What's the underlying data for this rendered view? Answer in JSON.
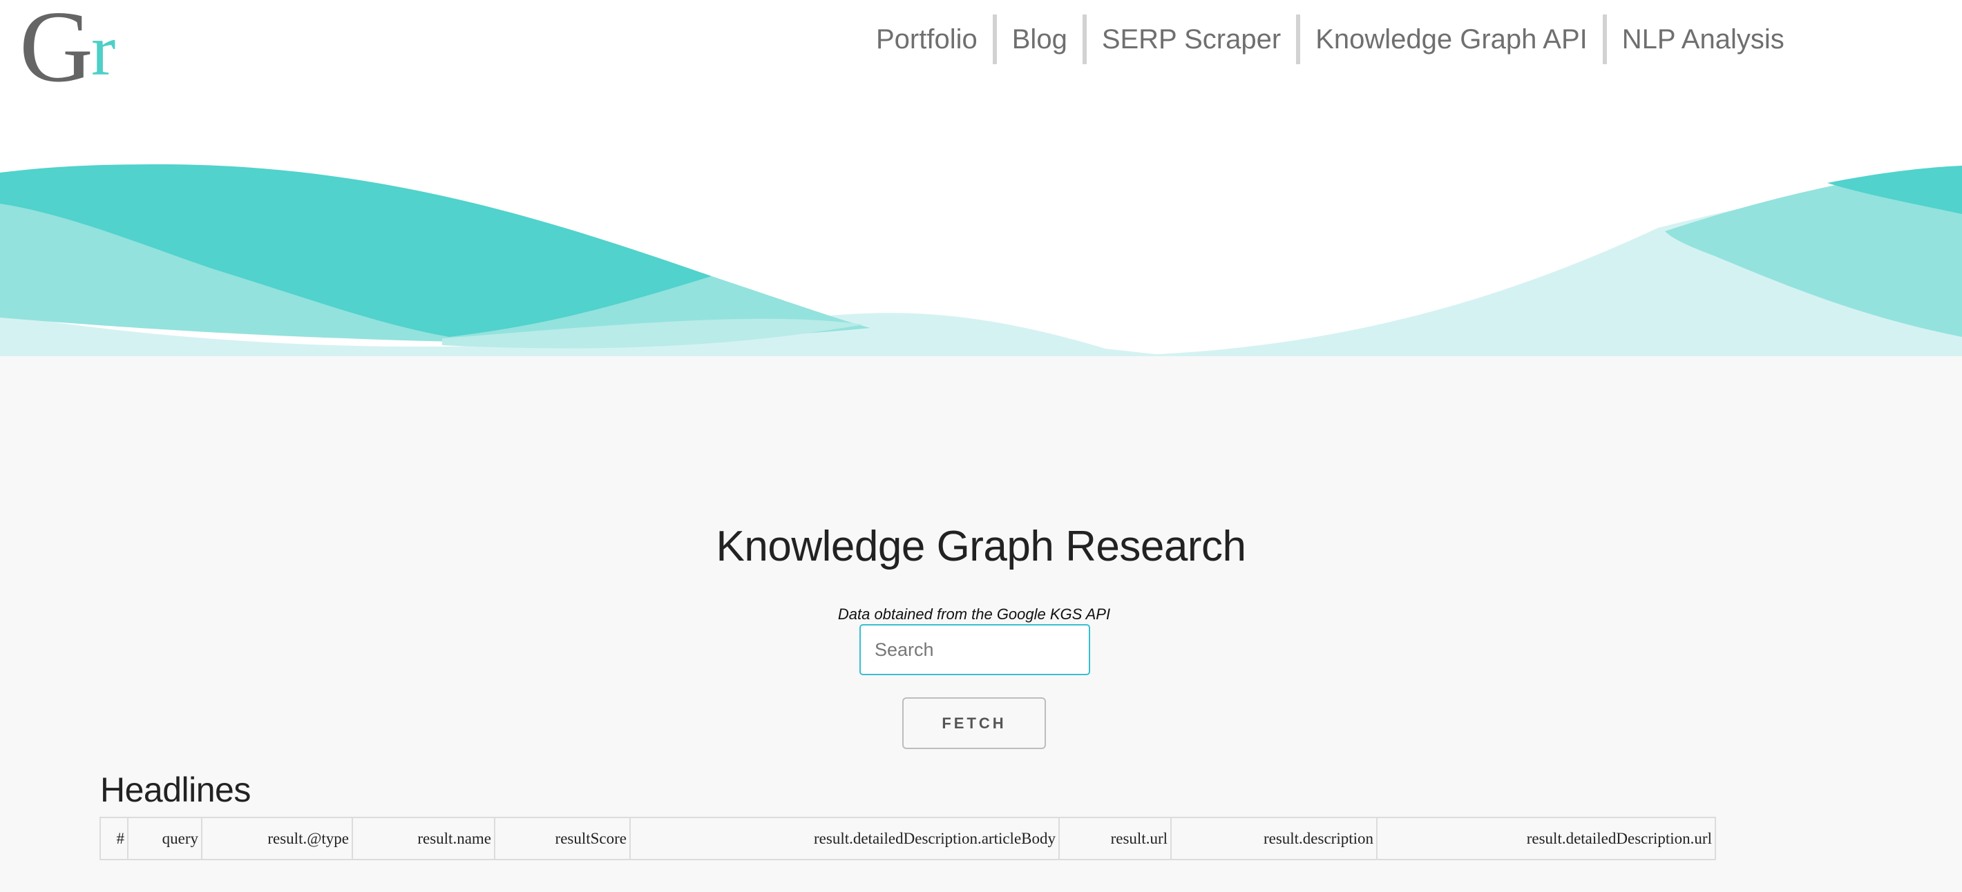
{
  "logo": {
    "letter_1": "G",
    "letter_2": "r"
  },
  "nav": {
    "items": [
      "Portfolio",
      "Blog",
      "SERP Scraper",
      "Knowledge Graph API",
      "NLP Analysis"
    ]
  },
  "page": {
    "title": "Knowledge Graph Research",
    "subtitle": "Data obtained from the Google KGS API"
  },
  "search": {
    "placeholder": "Search",
    "value": ""
  },
  "fetch_button": {
    "label": "FETCH"
  },
  "headlines": {
    "heading": "Headlines",
    "columns": [
      "#",
      "query",
      "result.@type",
      "result.name",
      "resultScore",
      "result.detailedDescription.articleBody",
      "result.url",
      "result.description",
      "result.detailedDescription.url"
    ]
  },
  "colors": {
    "accent": "#4ecfc8",
    "wave_dark": "#51d2cc",
    "wave_mid": "#93e2dd",
    "wave_light": "#d5f2f2",
    "background": "#f8f8f8"
  }
}
